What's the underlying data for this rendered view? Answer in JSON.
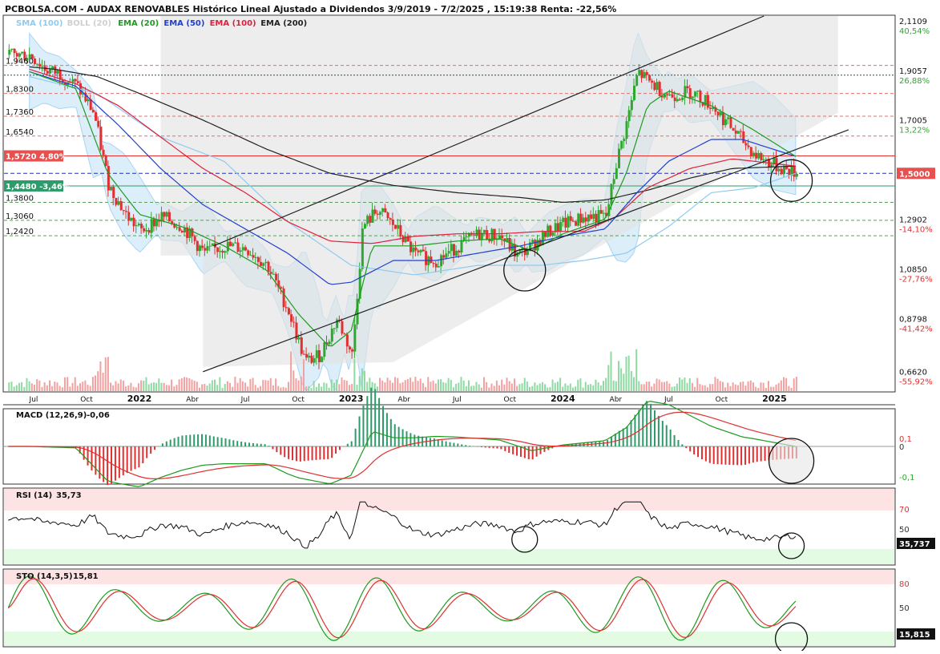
{
  "header": {
    "title": "PCBOLSA.COM - AUDAX RENOVABLES Histórico Lineal Ajustado a Dividendos 3/9/2019 - 7/2/2025 , 15:19:38 Renta: -22,56%"
  },
  "legend": [
    {
      "label": "SMA (100)",
      "color": "#8ecbf0"
    },
    {
      "label": "BOLL (20)",
      "color": "#cfcfcf"
    },
    {
      "label": "EMA (20)",
      "color": "#1f9a1f"
    },
    {
      "label": "EMA (50)",
      "color": "#2040d0"
    },
    {
      "label": "EMA (100)",
      "color": "#e0203c"
    },
    {
      "label": "EMA (200)",
      "color": "#222222"
    }
  ],
  "colors": {
    "up": "#2ea82e",
    "down": "#e03030",
    "last_price_bg": "#e85050",
    "support_bg": "#2e9b6a",
    "overbought": "#fde3e3",
    "oversold": "#e3fbe3"
  },
  "price_axis": {
    "ticks": [
      {
        "value": 2.1109,
        "label": "2,1109",
        "pct": "40,54%",
        "pct_color": "#2ea82e"
      },
      {
        "value": 1.9057,
        "label": "1,9057",
        "pct": "26,88%",
        "pct_color": "#2ea82e"
      },
      {
        "value": 1.7005,
        "label": "1,7005",
        "pct": "13,22%",
        "pct_color": "#2ea82e"
      },
      {
        "value": 1.2902,
        "label": "1,2902",
        "pct": "-14,10%",
        "pct_color": "#e03030"
      },
      {
        "value": 1.085,
        "label": "1,0850",
        "pct": "-27,76%",
        "pct_color": "#e03030"
      },
      {
        "value": 0.8798,
        "label": "0,8798",
        "pct": "-41,42%",
        "pct_color": "#e03030"
      },
      {
        "value": 0.662,
        "label": "0,6620",
        "pct": "-55,92%",
        "pct_color": "#e03030"
      }
    ],
    "last_price": "1,5000"
  },
  "left_levels": [
    {
      "value": 1.946,
      "label": "1,9460",
      "style": "plain"
    },
    {
      "value": 1.83,
      "label": "1,8300",
      "style": "plain"
    },
    {
      "value": 1.736,
      "label": "1,7360",
      "style": "plain"
    },
    {
      "value": 1.654,
      "label": "1,6540",
      "style": "plain"
    },
    {
      "value": 1.572,
      "label": "1,5720 4,80%",
      "style": "red"
    },
    {
      "value": 1.448,
      "label": "1,4480 -3,46%",
      "style": "green"
    },
    {
      "value": 1.38,
      "label": "1,3800",
      "style": "plain"
    },
    {
      "value": 1.306,
      "label": "1,3060",
      "style": "plain"
    },
    {
      "value": 1.242,
      "label": "1,2420",
      "style": "plain"
    }
  ],
  "time_axis": [
    {
      "t": 2021.5,
      "label": "Jul"
    },
    {
      "t": 2021.75,
      "label": "Oct"
    },
    {
      "t": 2022.0,
      "label": "2022"
    },
    {
      "t": 2022.25,
      "label": "Abr"
    },
    {
      "t": 2022.5,
      "label": "Jul"
    },
    {
      "t": 2022.75,
      "label": "Oct"
    },
    {
      "t": 2023.0,
      "label": "2023"
    },
    {
      "t": 2023.25,
      "label": "Abr"
    },
    {
      "t": 2023.5,
      "label": "Jul"
    },
    {
      "t": 2023.75,
      "label": "Oct"
    },
    {
      "t": 2024.0,
      "label": "2024"
    },
    {
      "t": 2024.25,
      "label": "Abr"
    },
    {
      "t": 2024.5,
      "label": "Jul"
    },
    {
      "t": 2024.75,
      "label": "Oct"
    },
    {
      "t": 2025.0,
      "label": "2025"
    }
  ],
  "panels": {
    "macd": {
      "title": "MACD (12,26,9)",
      "value": "-0,06",
      "ticks": [
        "0,1",
        "0",
        "-0,1"
      ]
    },
    "rsi": {
      "title": "RSI (14)",
      "value": "35,73",
      "ticks": [
        "70",
        "50"
      ],
      "last": "35,737"
    },
    "sto": {
      "title": "STO (14,3,5)",
      "value": "15,81",
      "ticks": [
        "80",
        "50"
      ],
      "last": "15,815"
    }
  },
  "chart_data": {
    "type": "line",
    "title": "PCBOLSA.COM - AUDAX RENOVABLES Histórico Lineal Ajustado a Dividendos 3/9/2019 - 7/2/2025 , 15:19:38 Renta: -22,56%",
    "x_range": [
      "Jul 2021",
      "Feb 2025"
    ],
    "ylim": [
      0.6,
      2.15
    ],
    "series": [
      {
        "name": "Precio",
        "x": [
          2021.48,
          2021.55,
          2021.62,
          2021.7,
          2021.78,
          2021.85,
          2021.93,
          2022.0,
          2022.1,
          2022.2,
          2022.3,
          2022.4,
          2022.5,
          2022.6,
          2022.7,
          2022.78,
          2022.85,
          2022.93,
          2023.0,
          2023.05,
          2023.12,
          2023.2,
          2023.3,
          2023.4,
          2023.5,
          2023.6,
          2023.7,
          2023.78,
          2023.85,
          2023.93,
          2024.0,
          2024.1,
          2024.2,
          2024.25,
          2024.3,
          2024.35,
          2024.4,
          2024.5,
          2024.6,
          2024.7,
          2024.8,
          2024.9,
          2025.0,
          2025.1
        ],
        "y": [
          1.99,
          1.93,
          1.91,
          1.86,
          1.75,
          1.45,
          1.33,
          1.26,
          1.32,
          1.28,
          1.17,
          1.2,
          1.19,
          1.12,
          0.93,
          0.72,
          0.75,
          0.9,
          0.75,
          1.28,
          1.35,
          1.28,
          1.16,
          1.14,
          1.2,
          1.25,
          1.24,
          1.16,
          1.2,
          1.26,
          1.29,
          1.32,
          1.32,
          1.55,
          1.72,
          1.92,
          1.88,
          1.82,
          1.84,
          1.78,
          1.68,
          1.58,
          1.53,
          1.5
        ]
      },
      {
        "name": "EMA (20)",
        "x": [
          2021.48,
          2021.7,
          2021.85,
          2022.0,
          2022.2,
          2022.4,
          2022.6,
          2022.75,
          2022.9,
          2023.0,
          2023.1,
          2023.3,
          2023.5,
          2023.7,
          2023.85,
          2024.0,
          2024.2,
          2024.3,
          2024.4,
          2024.5,
          2024.7,
          2024.9,
          2025.1
        ],
        "y": [
          1.92,
          1.85,
          1.5,
          1.33,
          1.28,
          1.2,
          1.1,
          0.92,
          0.78,
          0.85,
          1.2,
          1.2,
          1.22,
          1.23,
          1.18,
          1.25,
          1.31,
          1.5,
          1.78,
          1.84,
          1.78,
          1.68,
          1.57
        ]
      },
      {
        "name": "EMA (50)",
        "x": [
          2021.48,
          2021.7,
          2021.9,
          2022.1,
          2022.3,
          2022.5,
          2022.7,
          2022.9,
          2023.0,
          2023.2,
          2023.4,
          2023.6,
          2023.8,
          2024.0,
          2024.2,
          2024.35,
          2024.5,
          2024.7,
          2024.85,
          2025.1
        ],
        "y": [
          1.92,
          1.86,
          1.7,
          1.52,
          1.37,
          1.27,
          1.17,
          1.04,
          1.05,
          1.14,
          1.14,
          1.17,
          1.2,
          1.24,
          1.27,
          1.42,
          1.55,
          1.64,
          1.64,
          1.57
        ]
      },
      {
        "name": "EMA (100)",
        "x": [
          2021.48,
          2021.7,
          2021.9,
          2022.1,
          2022.3,
          2022.5,
          2022.7,
          2022.9,
          2023.1,
          2023.3,
          2023.5,
          2023.7,
          2023.9,
          2024.1,
          2024.25,
          2024.4,
          2024.6,
          2024.8,
          2025.1
        ],
        "y": [
          1.93,
          1.87,
          1.78,
          1.65,
          1.52,
          1.42,
          1.3,
          1.22,
          1.21,
          1.24,
          1.25,
          1.25,
          1.26,
          1.26,
          1.32,
          1.44,
          1.52,
          1.56,
          1.53
        ]
      },
      {
        "name": "EMA (200)",
        "x": [
          2021.48,
          2021.6,
          2021.8,
          2022.0,
          2022.3,
          2022.6,
          2022.9,
          2023.2,
          2023.5,
          2023.8,
          2024.0,
          2024.2,
          2024.4,
          2024.6,
          2024.8,
          2025.1
        ],
        "y": [
          1.94,
          1.93,
          1.9,
          1.83,
          1.72,
          1.6,
          1.5,
          1.45,
          1.42,
          1.4,
          1.38,
          1.39,
          1.43,
          1.48,
          1.52,
          1.53
        ]
      },
      {
        "name": "SMA (100)",
        "x": [
          2021.48,
          2021.8,
          2022.1,
          2022.4,
          2022.7,
          2023.0,
          2023.3,
          2023.6,
          2023.9,
          2024.1,
          2024.3,
          2024.5,
          2024.7,
          2024.9,
          2025.1
        ],
        "y": [
          1.9,
          1.83,
          1.65,
          1.55,
          1.3,
          1.12,
          1.08,
          1.12,
          1.12,
          1.14,
          1.17,
          1.28,
          1.42,
          1.44,
          1.5
        ]
      }
    ]
  }
}
